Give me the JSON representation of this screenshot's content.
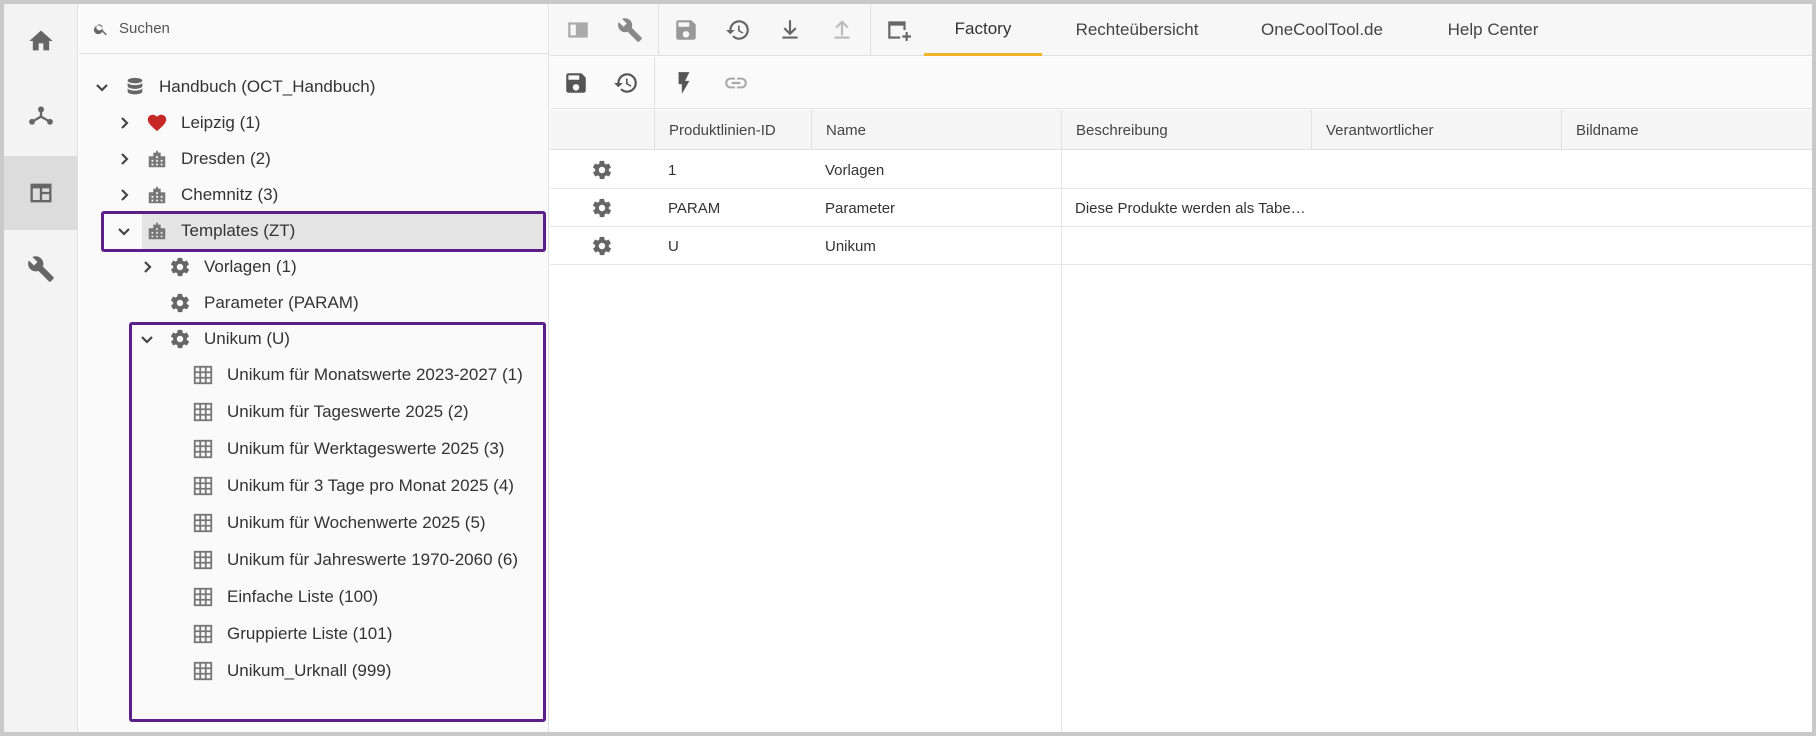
{
  "search": {
    "placeholder": "Suchen"
  },
  "tree": {
    "root": {
      "label": "Handbuch (OCT_Handbuch)",
      "icon": "database-icon"
    },
    "nodes": [
      {
        "label": "Leipzig (1)",
        "icon": "heart-icon"
      },
      {
        "label": "Dresden (2)",
        "icon": "building-icon"
      },
      {
        "label": "Chemnitz (3)",
        "icon": "building-icon"
      },
      {
        "label": "Templates (ZT)",
        "icon": "building-icon",
        "selected": true
      },
      {
        "label": "Vorlagen (1)",
        "icon": "gear-icon"
      },
      {
        "label": "Parameter (PARAM)",
        "icon": "gear-icon"
      },
      {
        "label": "Unikum (U)",
        "icon": "gear-icon"
      }
    ],
    "unikum_children": [
      {
        "label": "Unikum für Monatswerte 2023-2027 (1)"
      },
      {
        "label": "Unikum für Tageswerte 2025 (2)"
      },
      {
        "label": "Unikum für Werktageswerte 2025 (3)"
      },
      {
        "label": "Unikum für 3 Tage pro Monat 2025 (4)"
      },
      {
        "label": "Unikum für Wochenwerte 2025 (5)"
      },
      {
        "label": "Unikum für Jahreswerte 1970-2060 (6)"
      },
      {
        "label": "Einfache Liste (100)"
      },
      {
        "label": "Gruppierte Liste (101)"
      },
      {
        "label": "Unikum_Urknall (999)"
      }
    ]
  },
  "tabs": [
    {
      "label": "Factory",
      "active": true
    },
    {
      "label": "Rechteübersicht"
    },
    {
      "label": "OneCoolTool.de"
    },
    {
      "label": "Help Center"
    }
  ],
  "grid": {
    "columns": [
      "Produktlinien-ID",
      "Name",
      "Beschreibung",
      "Verantwortlicher",
      "Bildname"
    ],
    "rows": [
      {
        "id": "1",
        "name": "Vorlagen",
        "beschreibung": "",
        "verantwortlicher": "",
        "bildname": ""
      },
      {
        "id": "PARAM",
        "name": "Parameter",
        "beschreibung": "Diese Produkte werden als Tabe…",
        "verantwortlicher": "",
        "bildname": ""
      },
      {
        "id": "U",
        "name": "Unikum",
        "beschreibung": "",
        "verantwortlicher": "",
        "bildname": ""
      }
    ]
  },
  "colors": {
    "accent_tab": "#f0b429",
    "highlight": "#5b1f8a",
    "heart": "#c62828"
  }
}
